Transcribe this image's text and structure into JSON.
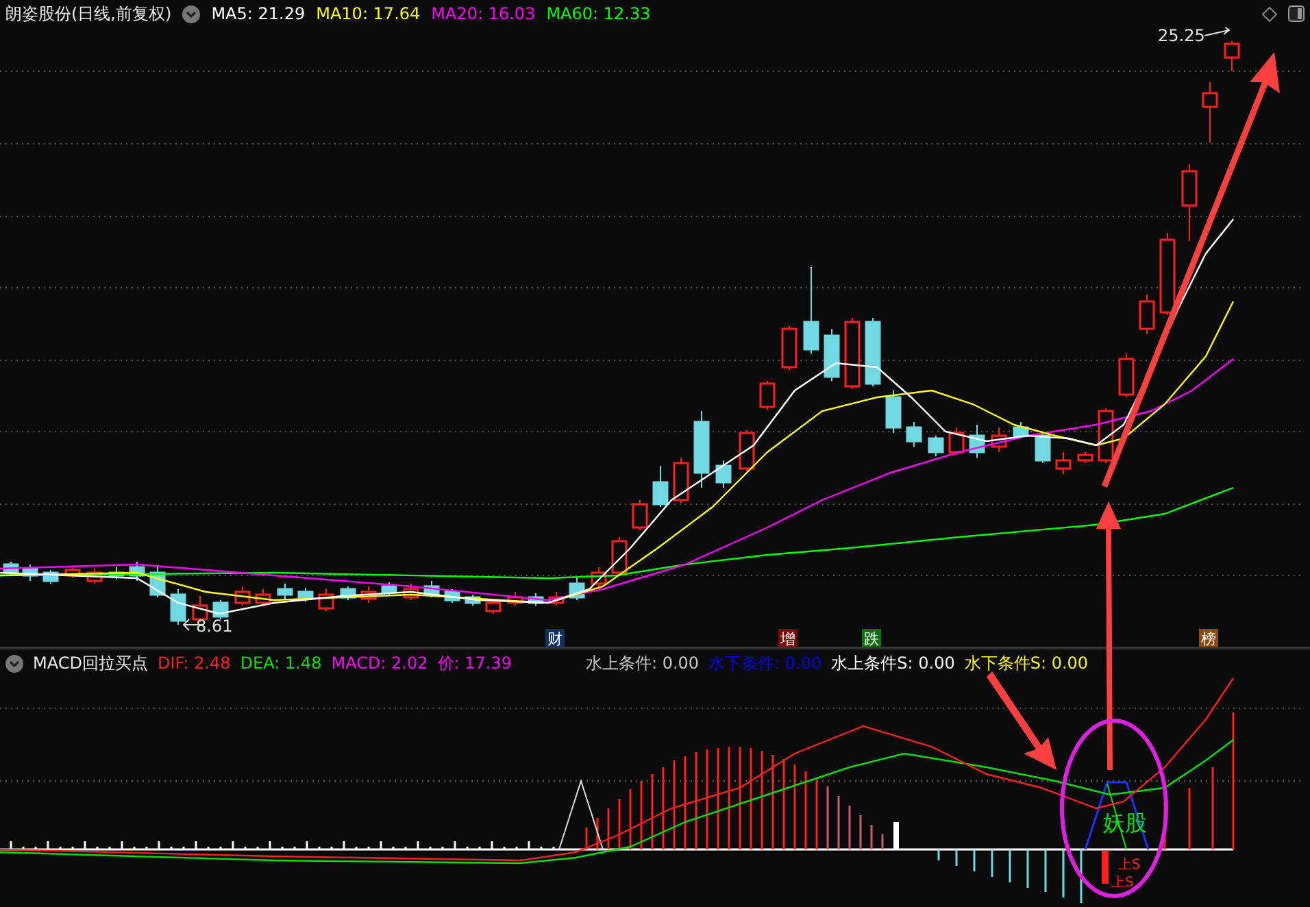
{
  "main_chart": {
    "title": "朗姿股份(日线,前复权)",
    "indicators": [
      {
        "label": "MA5: 21.29",
        "color": "#ffffff"
      },
      {
        "label": "MA10: 17.64",
        "color": "#ffff00"
      },
      {
        "label": "MA20: 16.03",
        "color": "#ff00ff"
      },
      {
        "label": "MA60: 12.33",
        "color": "#00ff00"
      }
    ],
    "high_label": "25.25",
    "low_label": "8.61",
    "event_markers": [
      {
        "text": "财",
        "color": "#12315e"
      },
      {
        "text": "增",
        "color": "#7a0a0a"
      },
      {
        "text": "跌",
        "color": "#0f6e12"
      },
      {
        "text": "榜",
        "color": "#8a4a10"
      }
    ]
  },
  "macd_panel": {
    "title": "MACD回拉买点",
    "readouts": [
      {
        "label": "DIF: 2.48",
        "color": "#ff2020"
      },
      {
        "label": "DEA: 1.48",
        "color": "#00e000"
      },
      {
        "label": "MACD: 2.02",
        "color": "#ff00ff"
      },
      {
        "label": "价: 17.39",
        "color": "#ff00ff"
      },
      {
        "label": "水上条件: 0.00",
        "color": "#c8c8c8"
      },
      {
        "label": "水下条件: 0.00",
        "color": "#0000ff"
      },
      {
        "label": "水上条件S: 0.00",
        "color": "#ffffff"
      },
      {
        "label": "水下条件S: 0.00",
        "color": "#ffff00"
      }
    ],
    "signal_labels": [
      {
        "text": "妖股",
        "color": "#00e000"
      },
      {
        "text": "上S",
        "color": "#ff2020"
      },
      {
        "text": "上S",
        "color": "#ff2020"
      }
    ]
  }
}
